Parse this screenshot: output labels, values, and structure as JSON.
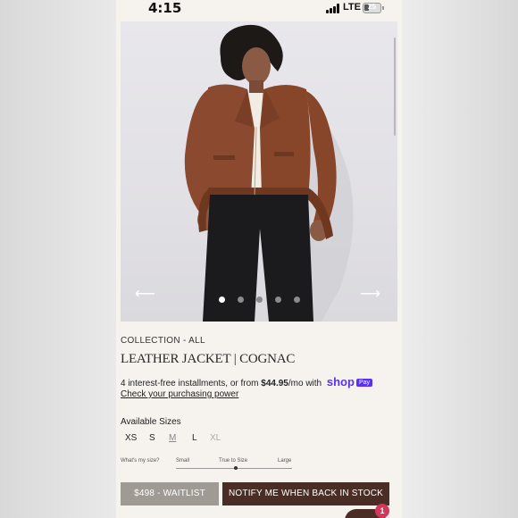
{
  "status_bar": {
    "time": "4:15",
    "network": "LTE",
    "battery_level": "25"
  },
  "gallery": {
    "image_alt": "model-in-leather-jacket",
    "prev_arrow": "⟵",
    "next_arrow": "⟶",
    "dot_count": 5,
    "active_dot": 0
  },
  "product": {
    "collection": "COLLECTION - ALL",
    "title": "LEATHER JACKET | COGNAC",
    "installments_prefix": "4 interest-free installments, or from ",
    "installment_amount": "$44.95",
    "installments_suffix": "/mo with ",
    "shop_label": "shop",
    "pay_label": "Pay",
    "check_power": "Check your purchasing power"
  },
  "sizes": {
    "label": "Available Sizes",
    "options": [
      "XS",
      "S",
      "M",
      "L",
      "XL"
    ]
  },
  "fit": {
    "question": "What's my size?",
    "small": "Small",
    "true_to_size": "True to Size",
    "large": "Large"
  },
  "actions": {
    "waitlist": "$498  -  WAITLIST",
    "notify": "NOTIFY ME WHEN BACK IN STOCK"
  },
  "chat": {
    "badge_count": "1"
  },
  "colors": {
    "background": "#f6f3ee",
    "waitlist_button": "#a09a94",
    "notify_button": "#4a2e26",
    "shop_pay": "#5a31f4",
    "badge": "#d6365a",
    "jacket": "#8b4a2f"
  }
}
